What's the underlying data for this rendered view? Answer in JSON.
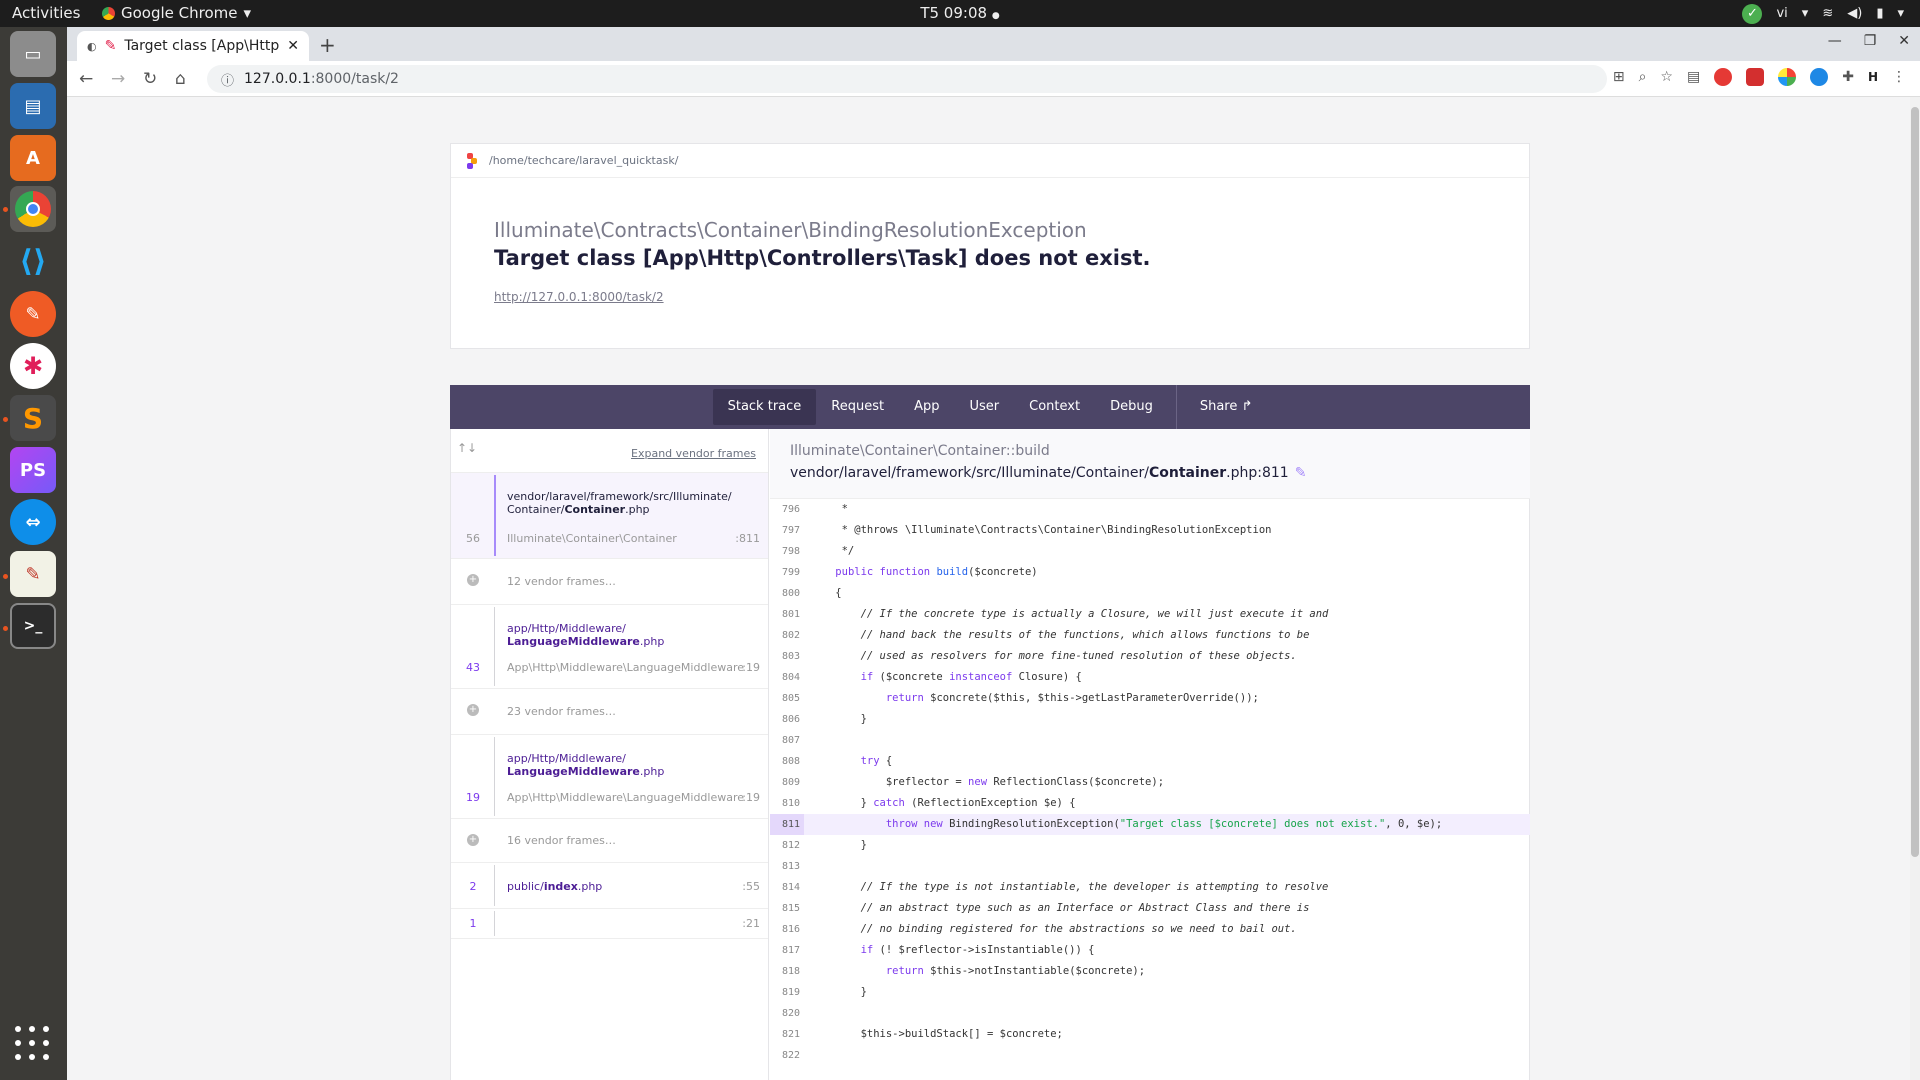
{
  "topbar": {
    "activities": "Activities",
    "app_name": "Google Chrome",
    "clock": "T5 09:08",
    "lang": "vi"
  },
  "chrome": {
    "tab_title": "Target class [App\\Http",
    "url_host": "127.0.0.1",
    "url_path": ":8000/task/2"
  },
  "header": {
    "path": "/home/techcare/laravel_quicktask/",
    "exception_class": "Illuminate\\Contracts\\Container\\BindingResolutionException",
    "message": "Target class [App\\Http\\Controllers\\Task] does not exist.",
    "url": "http://127.0.0.1:8000/task/2"
  },
  "nav": {
    "tabs": [
      "Stack trace",
      "Request",
      "App",
      "User",
      "Context",
      "Debug"
    ],
    "share": "Share"
  },
  "frames": {
    "expand": "Expand vendor frames",
    "f56": {
      "num": "56",
      "file_a": "vendor/laravel/framework/src/Illuminate/",
      "file_b": "Container/",
      "file_c": "Container",
      "file_d": ".php",
      "cls": "Illuminate\\Container\\Container",
      "line": ":811"
    },
    "v12": "12 vendor frames…",
    "f43": {
      "num": "43",
      "file_a": "app/Http/Middleware/",
      "file_c": "LanguageMiddleware",
      "file_d": ".php",
      "cls": "App\\Http\\Middleware\\LanguageMiddleware",
      "line": ":19"
    },
    "v23": "23 vendor frames…",
    "f19": {
      "num": "19",
      "file_a": "app/Http/Middleware/",
      "file_c": "LanguageMiddleware",
      "file_d": ".php",
      "cls": "App\\Http\\Middleware\\LanguageMiddleware",
      "line": ":19"
    },
    "v16": "16 vendor frames…",
    "f2": {
      "num": "2",
      "file_a": "public/",
      "file_c": "index",
      "file_d": ".php",
      "line": ":55"
    },
    "f1": {
      "num": "1",
      "line": ":21"
    }
  },
  "code": {
    "cls": "Illuminate\\Container\\Container::build",
    "file_prefix": "vendor/laravel/framework/src/Illuminate/Container/",
    "file_name": "Container",
    "file_suffix": ".php:811",
    "lines": {
      "l796": "796",
      "l797": "797",
      "l798": "798",
      "l799": "799",
      "l800": "800",
      "l801": "801",
      "l802": "802",
      "l803": "803",
      "l804": "804",
      "l805": "805",
      "l806": "806",
      "l807": "807",
      "l808": "808",
      "l809": "809",
      "l810": "810",
      "l811": "811",
      "l812": "812",
      "l813": "813",
      "l814": "814",
      "l815": "815",
      "l816": "816",
      "l817": "817",
      "l818": "818",
      "l819": "819",
      "l820": "820",
      "l821": "821",
      "l822": "822"
    },
    "src": {
      "s796": "     *",
      "s797": "     * @throws \\Illuminate\\Contracts\\Container\\BindingResolutionException",
      "s798": "     */",
      "s799a": "public",
      "s799b": " function ",
      "s799c": "build",
      "s799d": "($concrete)",
      "s800": "    {",
      "s801": "        // If the concrete type is actually a Closure, we will just execute it and",
      "s802": "        // hand back the results of the functions, which allows functions to be",
      "s803": "        // used as resolvers for more fine-tuned resolution of these objects.",
      "s804a": "        if",
      "s804b": " ($concrete ",
      "s804c": "instanceof",
      "s804d": " Closure) {",
      "s805a": "            return",
      "s805b": " $concrete($this, $this->getLastParameterOverride());",
      "s806": "        }",
      "s808a": "        try",
      "s808b": " {",
      "s809a": "            $reflector = ",
      "s809b": "new",
      "s809c": " ReflectionClass($concrete);",
      "s810a": "        } ",
      "s810b": "catch",
      "s810c": " (ReflectionException $e) {",
      "s811a": "            throw new",
      "s811b": " BindingResolutionException(",
      "s811c": "\"Target class [$concrete] does not exist.\"",
      "s811d": ", 0, $e);",
      "s812": "        }",
      "s814": "        // If the type is not instantiable, the developer is attempting to resolve",
      "s815": "        // an abstract type such as an Interface or Abstract Class and there is",
      "s816": "        // no binding registered for the abstractions so we need to bail out.",
      "s817a": "        if",
      "s817b": " (! $reflector->isInstantiable()) {",
      "s818a": "            return",
      "s818b": " $this->notInstantiable($concrete);",
      "s819": "        }",
      "s821": "        $this->buildStack[] = $concrete;"
    }
  }
}
